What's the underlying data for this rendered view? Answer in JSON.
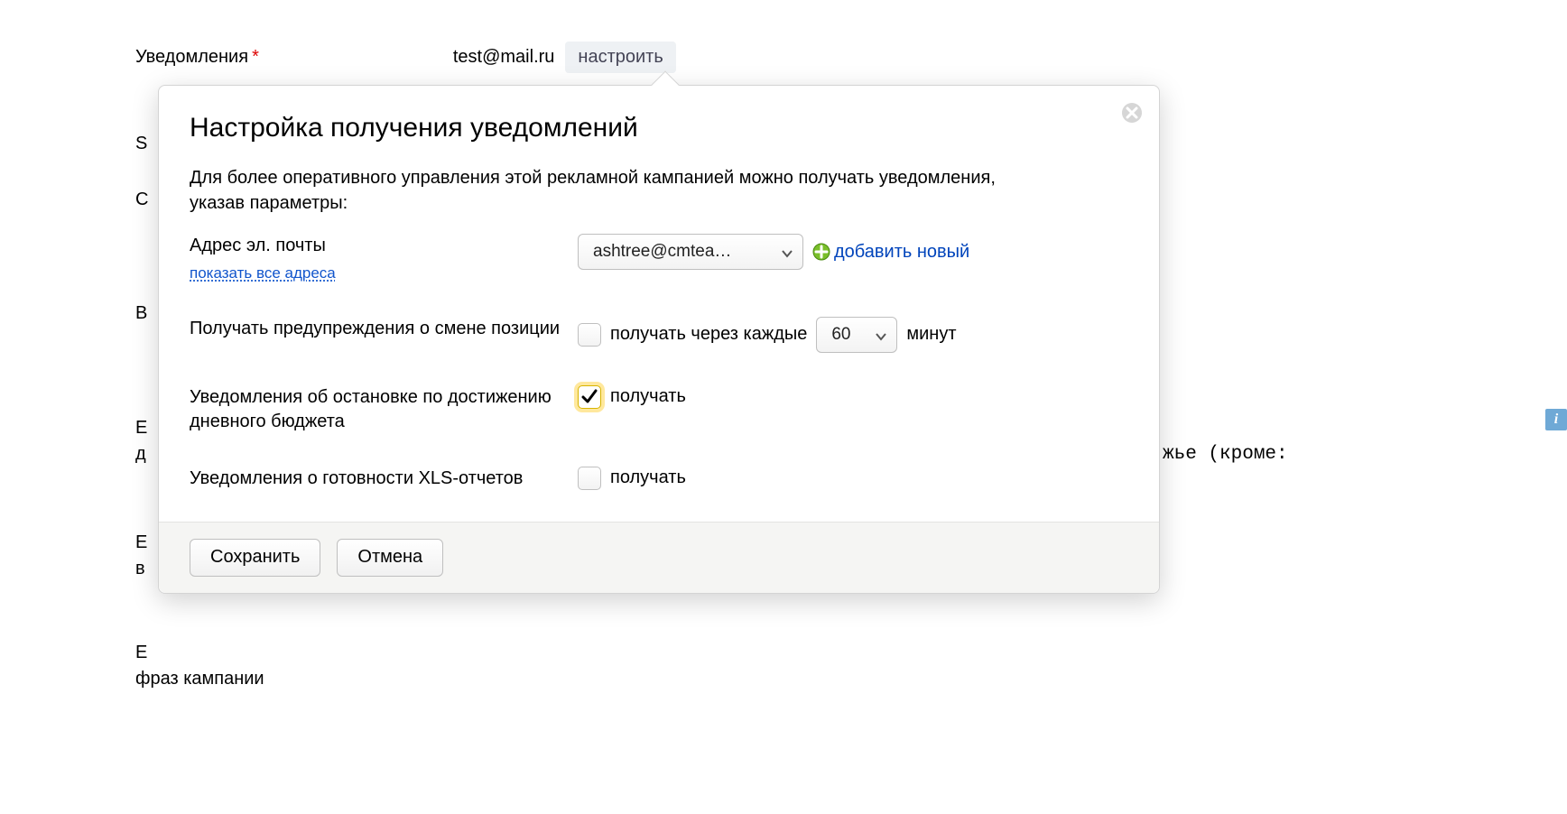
{
  "background": {
    "notifications_label": "Уведомления",
    "required_marker": "*",
    "email_value": "test@mail.ru",
    "configure_label": "настроить",
    "letters": {
      "s": "S",
      "c": "С",
      "v": "В",
      "e1_left": "Е",
      "e1_bot": "д",
      "e2_left": "Е",
      "e2_bot": "в",
      "e3_left": "Е",
      "e3_bot": "фраз кампании"
    },
    "right_fragment": "жье (кроме:"
  },
  "info_badge": "i",
  "dialog": {
    "title": "Настройка получения уведомлений",
    "description": "Для более оперативного управления этой рекламной кампанией можно получать уведомления, указав параметры:",
    "email_row": {
      "label": "Адрес эл. почты",
      "show_all": "показать все адреса",
      "selected": "ashtree@cmtea…",
      "add_new": "добавить новый"
    },
    "position_row": {
      "label": "Получать предупреждения о смене позиции",
      "receive_every": "получать через каждые",
      "interval_value": "60",
      "minutes": "минут"
    },
    "budget_row": {
      "label": "Уведомления об остановке по достижению дневного бюджета",
      "receive": "получать"
    },
    "xls_row": {
      "label": "Уведомления о готовности XLS-отчетов",
      "receive": "получать"
    },
    "footer": {
      "save": "Сохранить",
      "cancel": "Отмена"
    }
  }
}
